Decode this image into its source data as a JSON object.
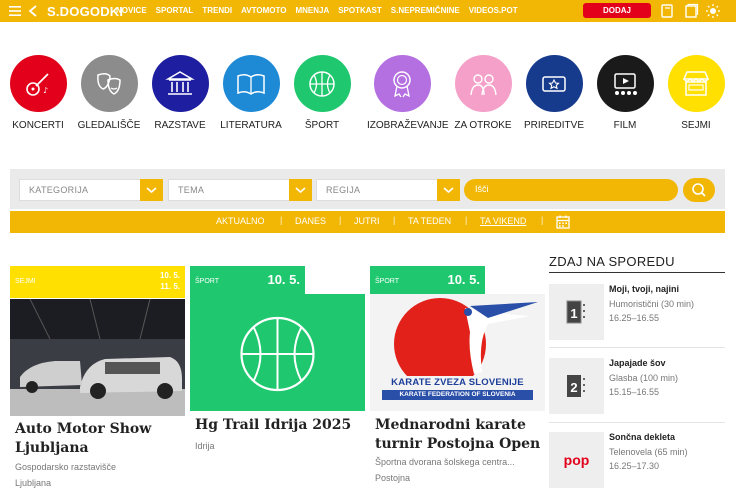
{
  "header": {
    "logo": "S.DOGODKI",
    "nav": [
      "NOVICE",
      "SPORTAL",
      "TRENDI",
      "AVTOMOTO",
      "MNENJA",
      "SPOTKAST",
      "S.NEPREMIČNINE",
      "VIDEOS.POT"
    ],
    "add_event": "DODAJ DOGODEK",
    "icons": [
      "menu-icon",
      "back-icon",
      "bookmark-icon",
      "history-icon",
      "sun-icon"
    ],
    "colors": {
      "bar": "#f2b705",
      "add_button": "#e2001a"
    }
  },
  "categories": [
    {
      "label": "KONCERTI",
      "color": "#e2001a",
      "icon": "guitar-icon"
    },
    {
      "label": "GLEDALIŠČE",
      "color": "#8c8c8c",
      "icon": "theater-masks-icon"
    },
    {
      "label": "RAZSTAVE",
      "color": "#1e1ea0",
      "icon": "museum-icon"
    },
    {
      "label": "LITERATURA",
      "color": "#1e8ad6",
      "icon": "book-icon"
    },
    {
      "label": "ŠPORT",
      "color": "#1fc86e",
      "icon": "basketball-icon"
    },
    {
      "label": "IZOBRAŽEVANJE",
      "color": "#b46fe0",
      "icon": "medal-icon"
    },
    {
      "label": "ZA OTROKE",
      "color": "#f5a0c8",
      "icon": "children-icon"
    },
    {
      "label": "PRIREDITVE",
      "color": "#163a8c",
      "icon": "ticket-icon"
    },
    {
      "label": "FILM",
      "color": "#1a1a1a",
      "icon": "cinema-icon"
    },
    {
      "label": "SEJMI",
      "color": "#ffe000",
      "icon": "market-stall-icon"
    }
  ],
  "filters": {
    "category": "KATEGORIJA",
    "topic": "TEMA",
    "region": "REGIJA",
    "search_placeholder": "Išči"
  },
  "date_tabs": [
    "AKTUALNO",
    "DANES",
    "JUTRI",
    "TA TEDEN",
    "TA VIKEND"
  ],
  "active_date_tab": "TA VIKEND",
  "events": [
    {
      "tag": "SEJMI",
      "date": "10. 5.",
      "date_end": "11. 5.",
      "title": "Auto Motor Show Ljubljana",
      "venue": "Gospodarsko razstavišče",
      "city": "Ljubljana",
      "color": "#ffe000"
    },
    {
      "tag": "ŠPORT",
      "date": "10. 5.",
      "title": "Hg Trail Idrija 2025",
      "venue": "Idrija",
      "color": "#1fc86e"
    },
    {
      "tag": "ŠPORT",
      "date": "10. 5.",
      "title": "Mednarodni karate turnir Postojna Open",
      "venue": "Športna dvorana šolskega centra...",
      "city": "Postojna",
      "color": "#1fc86e",
      "logo_text": [
        "KARATE ZVEZA SLOVENIJE",
        "KARATE FEDERATION OF SLOVENIA"
      ]
    }
  ],
  "schedule": {
    "title": "ZDAJ NA SPOREDU",
    "items": [
      {
        "title": "Moji, tvoji, najini",
        "genre": "Humoristični (30 min)",
        "time": "16.25–16.55",
        "channel": "1"
      },
      {
        "title": "Japajade šov",
        "genre": "Glasba (100 min)",
        "time": "15.15–16.55",
        "channel": "2"
      },
      {
        "title": "Sončna dekleta",
        "genre": "Telenovela (65 min)",
        "time": "16.25–17.30",
        "channel": "pop"
      }
    ]
  }
}
